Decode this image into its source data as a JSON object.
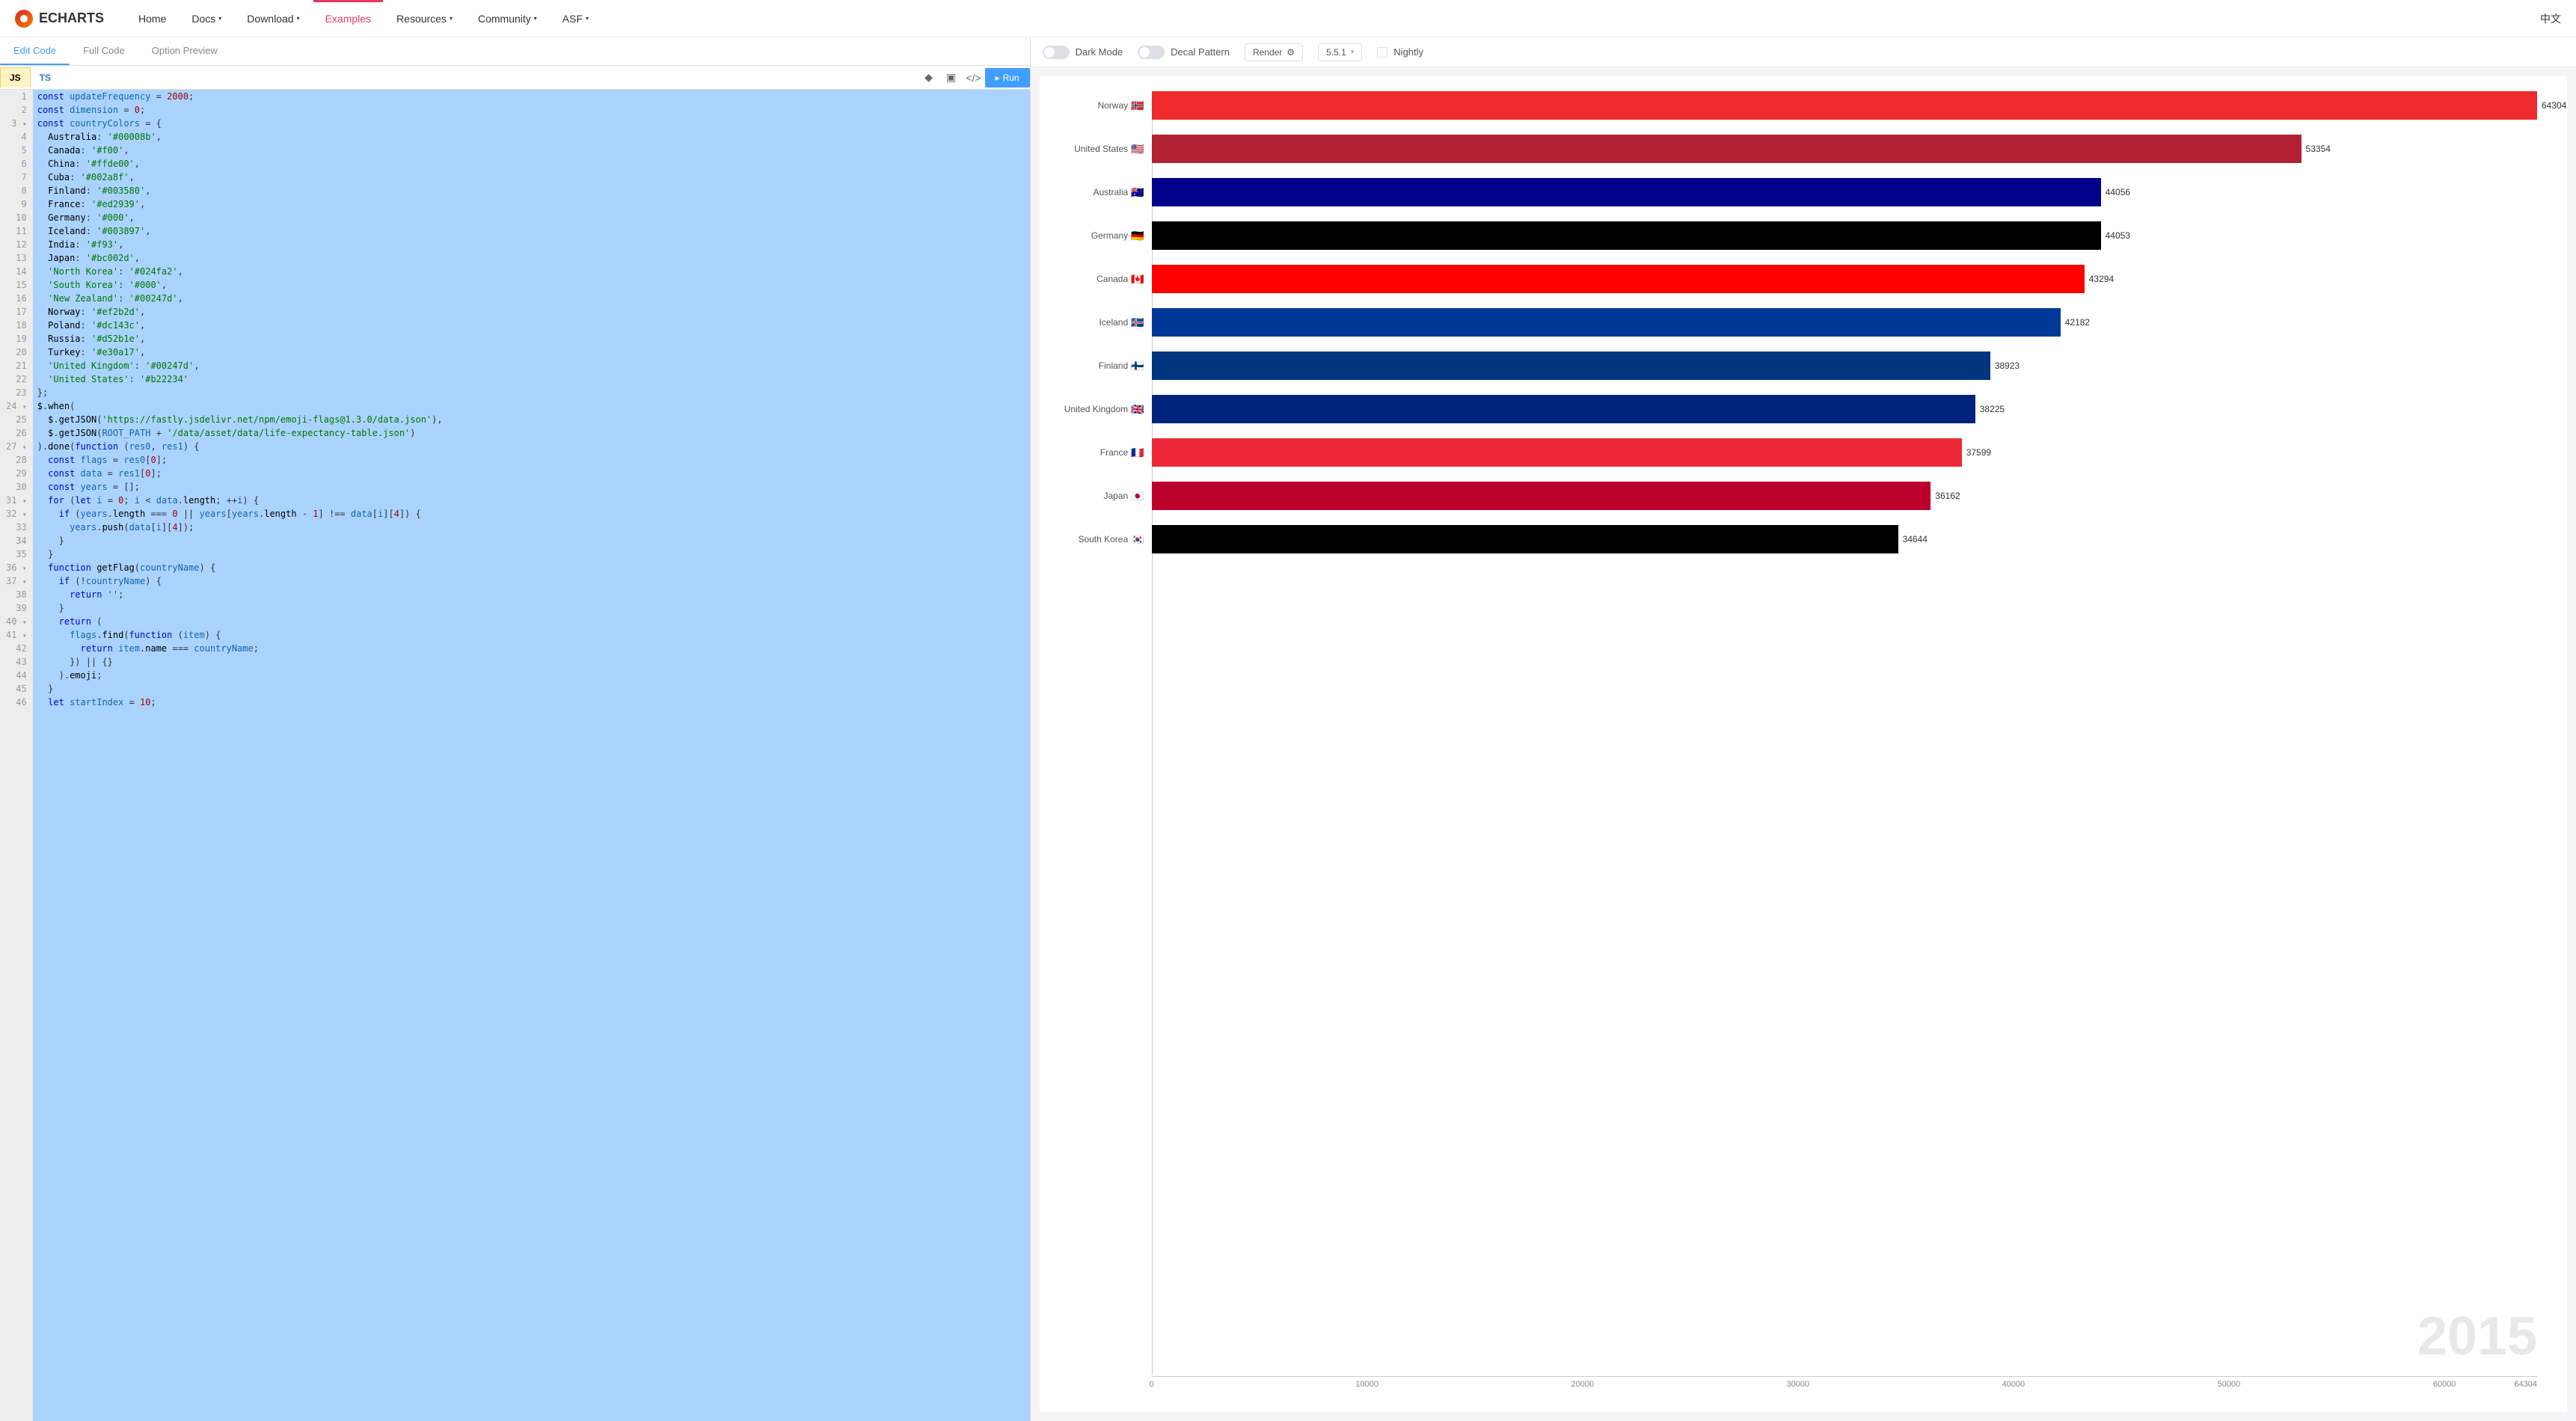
{
  "header": {
    "brand": "ECHARTS",
    "nav": [
      {
        "label": "Home",
        "caret": false
      },
      {
        "label": "Docs",
        "caret": true
      },
      {
        "label": "Download",
        "caret": true
      },
      {
        "label": "Examples",
        "caret": false,
        "active": true
      },
      {
        "label": "Resources",
        "caret": true
      },
      {
        "label": "Community",
        "caret": true
      },
      {
        "label": "ASF",
        "caret": true
      }
    ],
    "lang_toggle": "中文"
  },
  "code_tabs": {
    "edit": "Edit Code",
    "full": "Full Code",
    "preview": "Option Preview"
  },
  "lang_tabs": {
    "js": "JS",
    "ts": "TS"
  },
  "run_button": "Run",
  "chart_toolbar": {
    "dark_mode": "Dark Mode",
    "decal": "Decal Pattern",
    "render": "Render",
    "version": "5.5.1",
    "nightly": "Nightly"
  },
  "code_lines": [
    {
      "n": 1,
      "html": "<span class='kw'>const</span> <span class='var'>updateFrequency</span> = <span class='num'>2000</span>;"
    },
    {
      "n": 2,
      "html": "<span class='kw'>const</span> <span class='var'>dimension</span> = <span class='num'>0</span>;"
    },
    {
      "n": 3,
      "html": "<span class='kw'>const</span> <span class='var'>countryColors</span> = {",
      "fold": true
    },
    {
      "n": 4,
      "html": "  <span class='prop'>Australia</span>: <span class='str'>'#00008b'</span>,"
    },
    {
      "n": 5,
      "html": "  <span class='prop'>Canada</span>: <span class='str'>'#f00'</span>,"
    },
    {
      "n": 6,
      "html": "  <span class='prop'>China</span>: <span class='str'>'#ffde00'</span>,"
    },
    {
      "n": 7,
      "html": "  <span class='prop'>Cuba</span>: <span class='str'>'#002a8f'</span>,"
    },
    {
      "n": 8,
      "html": "  <span class='prop'>Finland</span>: <span class='str'>'#003580'</span>,"
    },
    {
      "n": 9,
      "html": "  <span class='prop'>France</span>: <span class='str'>'#ed2939'</span>,"
    },
    {
      "n": 10,
      "html": "  <span class='prop'>Germany</span>: <span class='str'>'#000'</span>,"
    },
    {
      "n": 11,
      "html": "  <span class='prop'>Iceland</span>: <span class='str'>'#003897'</span>,"
    },
    {
      "n": 12,
      "html": "  <span class='prop'>India</span>: <span class='str'>'#f93'</span>,"
    },
    {
      "n": 13,
      "html": "  <span class='prop'>Japan</span>: <span class='str'>'#bc002d'</span>,"
    },
    {
      "n": 14,
      "html": "  <span class='str'>'North Korea'</span>: <span class='str'>'#024fa2'</span>,"
    },
    {
      "n": 15,
      "html": "  <span class='str'>'South Korea'</span>: <span class='str'>'#000'</span>,"
    },
    {
      "n": 16,
      "html": "  <span class='str'>'New Zealand'</span>: <span class='str'>'#00247d'</span>,"
    },
    {
      "n": 17,
      "html": "  <span class='prop'>Norway</span>: <span class='str'>'#ef2b2d'</span>,"
    },
    {
      "n": 18,
      "html": "  <span class='prop'>Poland</span>: <span class='str'>'#dc143c'</span>,"
    },
    {
      "n": 19,
      "html": "  <span class='prop'>Russia</span>: <span class='str'>'#d52b1e'</span>,"
    },
    {
      "n": 20,
      "html": "  <span class='prop'>Turkey</span>: <span class='str'>'#e30a17'</span>,"
    },
    {
      "n": 21,
      "html": "  <span class='str'>'United Kingdom'</span>: <span class='str'>'#00247d'</span>,"
    },
    {
      "n": 22,
      "html": "  <span class='str'>'United States'</span>: <span class='str'>'#b22234'</span>"
    },
    {
      "n": 23,
      "html": "};"
    },
    {
      "n": 24,
      "html": "<span class='ident'>$</span>.<span class='fn'>when</span>(",
      "fold": true
    },
    {
      "n": 25,
      "html": "  <span class='ident'>$</span>.<span class='fn'>getJSON</span>(<span class='str'>'https://fastly.jsdelivr.net/npm/emoji-flags@1.3.0/data.json'</span>),"
    },
    {
      "n": 26,
      "html": "  <span class='ident'>$</span>.<span class='fn'>getJSON</span>(<span class='var'>ROOT_PATH</span> + <span class='str'>'/data/asset/data/life-expectancy-table.json'</span>)"
    },
    {
      "n": 27,
      "html": ").<span class='fn'>done</span>(<span class='kw'>function</span> (<span class='var'>res0</span>, <span class='var'>res1</span>) {",
      "fold": true
    },
    {
      "n": 28,
      "html": "  <span class='kw'>const</span> <span class='var'>flags</span> = <span class='var'>res0</span>[<span class='num'>0</span>];"
    },
    {
      "n": 29,
      "html": "  <span class='kw'>const</span> <span class='var'>data</span> = <span class='var'>res1</span>[<span class='num'>0</span>];"
    },
    {
      "n": 30,
      "html": "  <span class='kw'>const</span> <span class='var'>years</span> = [];"
    },
    {
      "n": 31,
      "html": "  <span class='kw'>for</span> (<span class='kw'>let</span> <span class='var'>i</span> = <span class='num'>0</span>; <span class='var'>i</span> &lt; <span class='var'>data</span>.<span class='prop'>length</span>; ++<span class='var'>i</span>) {",
      "fold": true
    },
    {
      "n": 32,
      "html": "    <span class='kw'>if</span> (<span class='var'>years</span>.<span class='prop'>length</span> === <span class='num'>0</span> || <span class='var'>years</span>[<span class='var'>years</span>.<span class='prop'>length</span> - <span class='num'>1</span>] !== <span class='var'>data</span>[<span class='var'>i</span>][<span class='num'>4</span>]) {",
      "fold": true
    },
    {
      "n": 33,
      "html": "      <span class='var'>years</span>.<span class='fn'>push</span>(<span class='var'>data</span>[<span class='var'>i</span>][<span class='num'>4</span>]);"
    },
    {
      "n": 34,
      "html": "    }"
    },
    {
      "n": 35,
      "html": "  }"
    },
    {
      "n": 36,
      "html": "  <span class='kw'>function</span> <span class='fn'>getFlag</span>(<span class='var'>countryName</span>) {",
      "fold": true
    },
    {
      "n": 37,
      "html": "    <span class='kw'>if</span> (!<span class='var'>countryName</span>) {",
      "fold": true
    },
    {
      "n": 38,
      "html": "      <span class='kw'>return</span> <span class='str'>''</span>;"
    },
    {
      "n": 39,
      "html": "    }"
    },
    {
      "n": 40,
      "html": "    <span class='kw'>return</span> (",
      "fold": true
    },
    {
      "n": 41,
      "html": "      <span class='var'>flags</span>.<span class='fn'>find</span>(<span class='kw'>function</span> (<span class='var'>item</span>) {",
      "fold": true
    },
    {
      "n": 42,
      "html": "        <span class='kw'>return</span> <span class='var'>item</span>.<span class='prop'>name</span> === <span class='var'>countryName</span>;"
    },
    {
      "n": 43,
      "html": "      }) || {}"
    },
    {
      "n": 44,
      "html": "    ).<span class='prop'>emoji</span>;"
    },
    {
      "n": 45,
      "html": "  }"
    },
    {
      "n": 46,
      "html": "  <span class='kw'>let</span> <span class='var'>startIndex</span> = <span class='num'>10</span>;"
    }
  ],
  "chart_data": {
    "type": "bar",
    "year_label": "2015",
    "x_max": 64304,
    "x_ticks": [
      0,
      10000,
      20000,
      30000,
      40000,
      50000,
      60000,
      64304
    ],
    "bars": [
      {
        "label": "Norway",
        "flag": "🇳🇴",
        "value": 64304,
        "color": "#ef2b2d"
      },
      {
        "label": "United States",
        "flag": "🇺🇸",
        "value": 53354,
        "color": "#b22234"
      },
      {
        "label": "Australia",
        "flag": "🇦🇺",
        "value": 44056,
        "color": "#00008b"
      },
      {
        "label": "Germany",
        "flag": "🇩🇪",
        "value": 44053,
        "color": "#000000"
      },
      {
        "label": "Canada",
        "flag": "🇨🇦",
        "value": 43294,
        "color": "#ff0000"
      },
      {
        "label": "Iceland",
        "flag": "🇮🇸",
        "value": 42182,
        "color": "#003897"
      },
      {
        "label": "Finland",
        "flag": "🇫🇮",
        "value": 38923,
        "color": "#003580"
      },
      {
        "label": "United Kingdom",
        "flag": "🇬🇧",
        "value": 38225,
        "color": "#00247d"
      },
      {
        "label": "France",
        "flag": "🇫🇷",
        "value": 37599,
        "color": "#ed2939"
      },
      {
        "label": "Japan",
        "flag": "🇯🇵",
        "value": 36162,
        "color": "#bc002d"
      },
      {
        "label": "South Korea",
        "flag": "🇰🇷",
        "value": 34644,
        "color": "#000000"
      }
    ]
  }
}
